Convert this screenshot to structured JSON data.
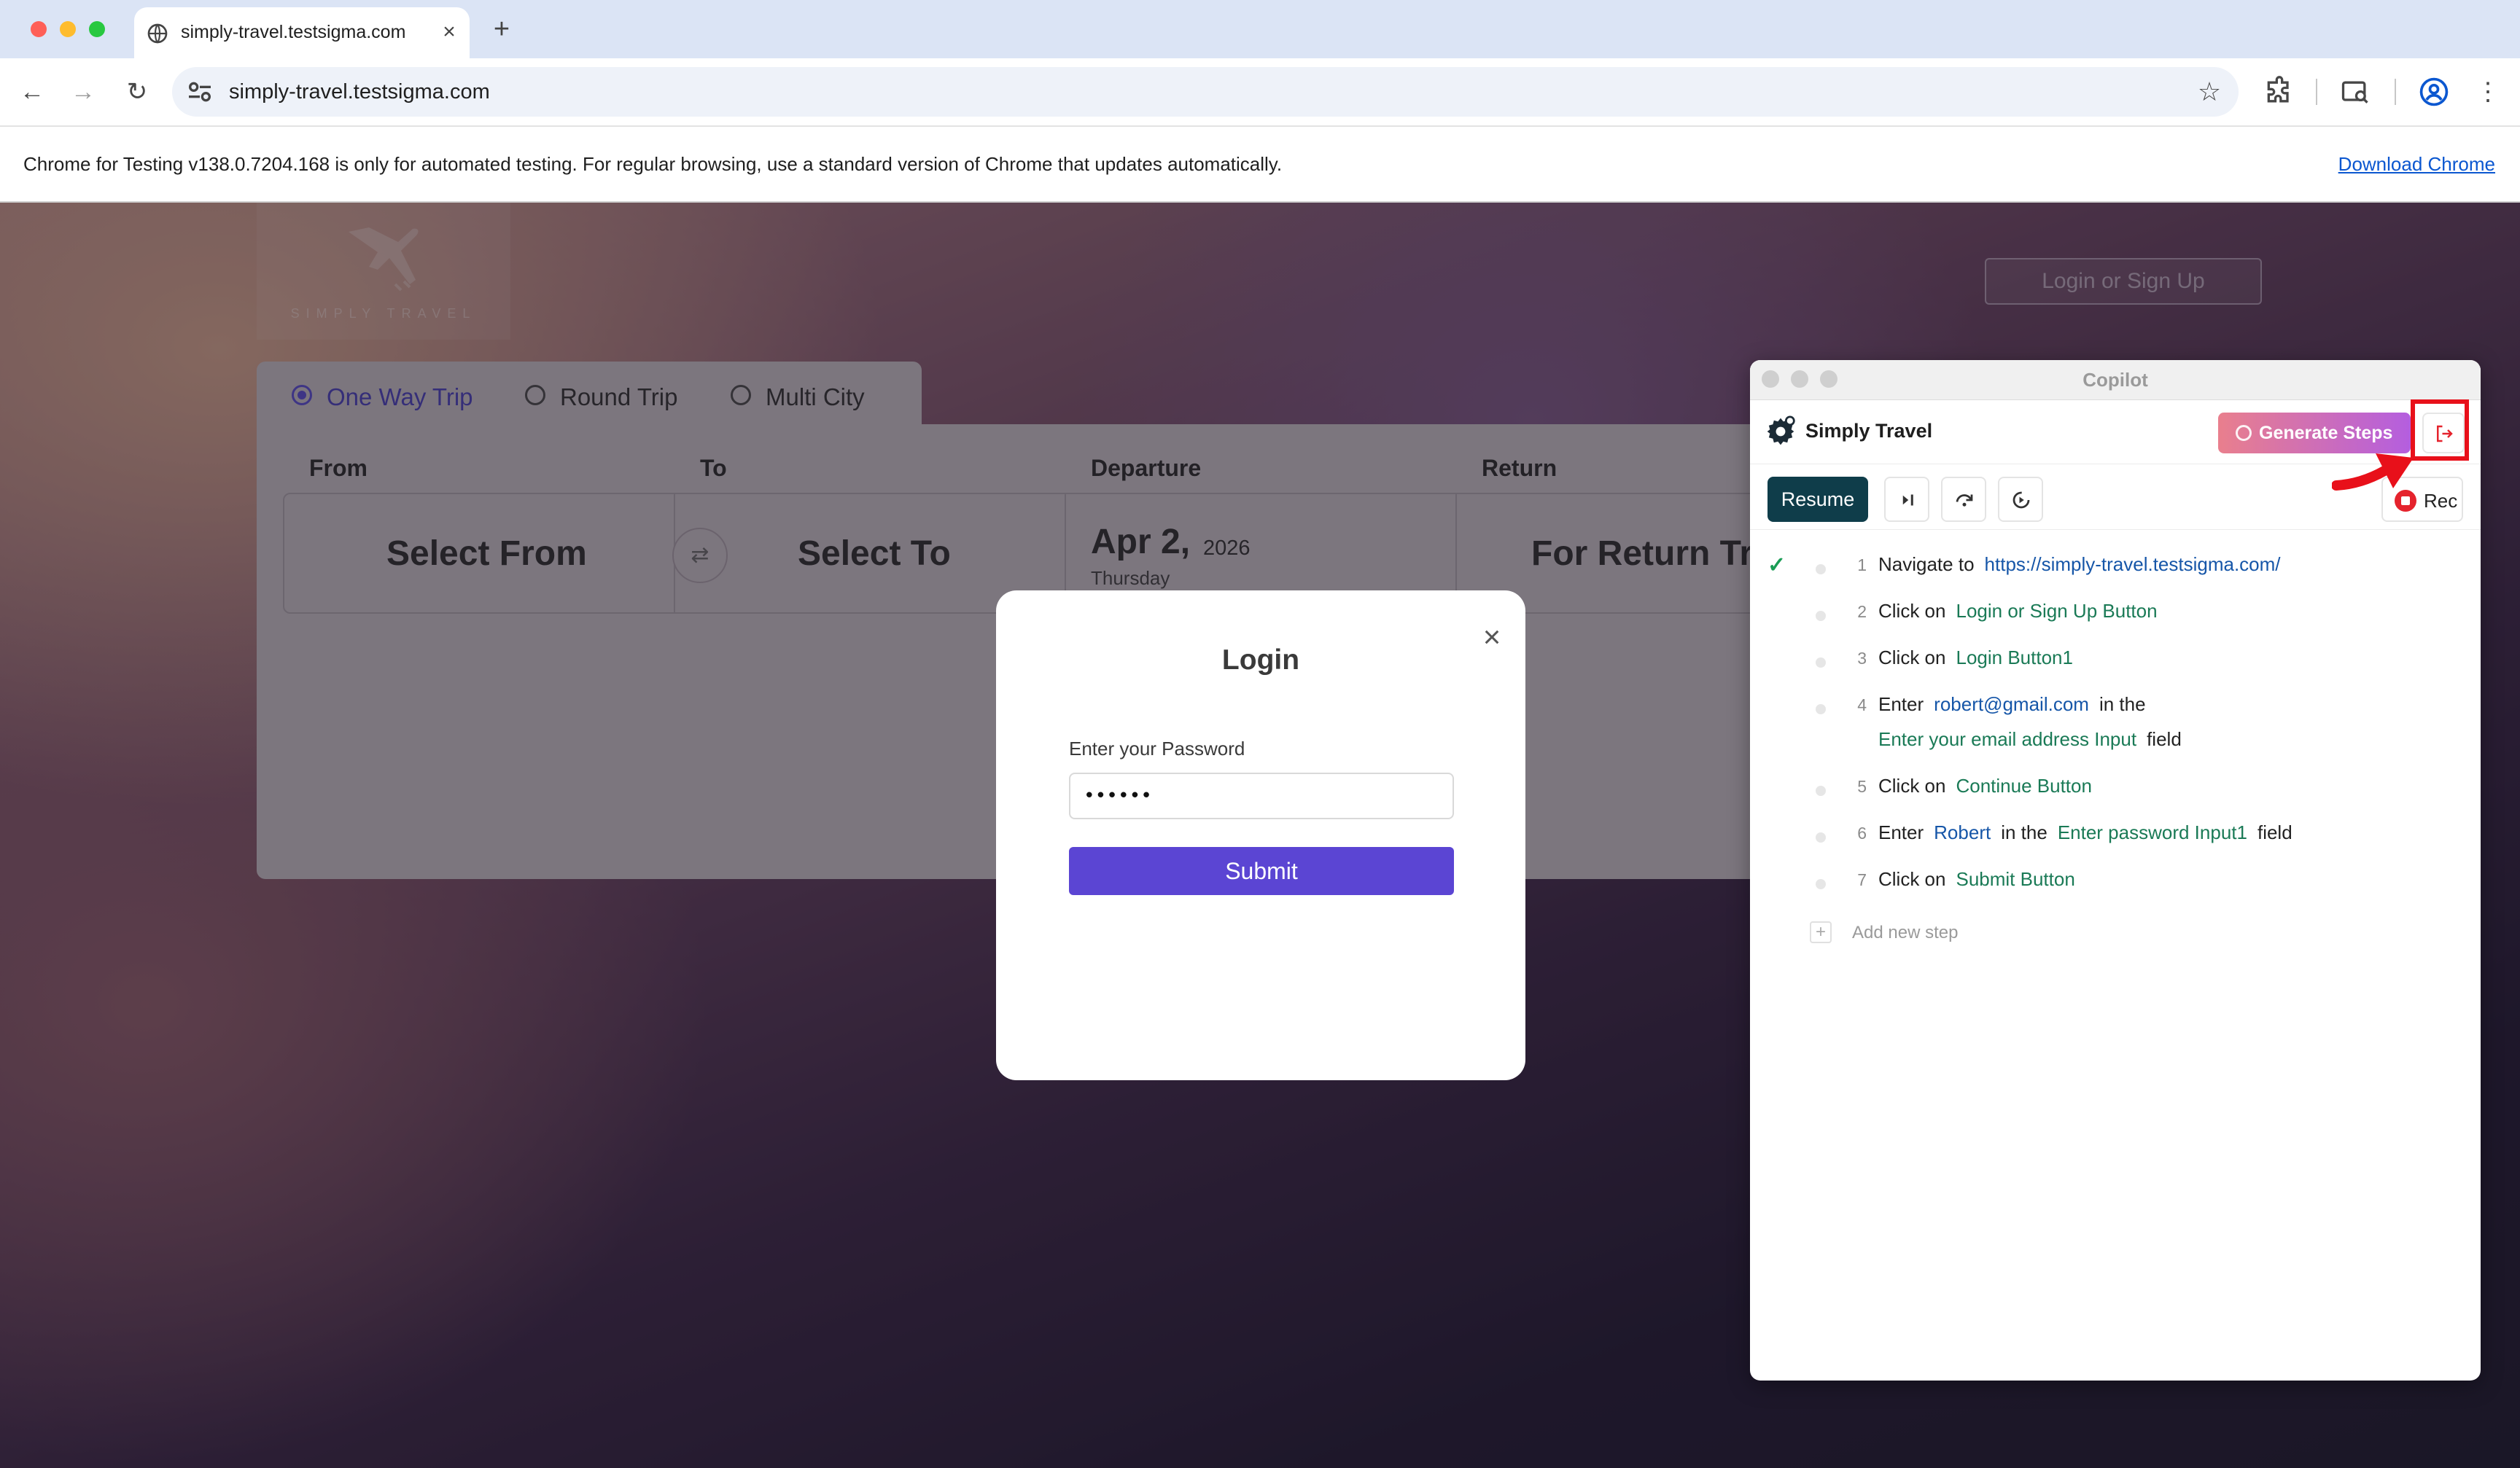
{
  "browser": {
    "tab_title": "simply-travel.testsigma.com",
    "new_tab": "+",
    "tab_close": "×",
    "url": "simply-travel.testsigma.com",
    "infobar_message": "Chrome for Testing v138.0.7204.168 is only for automated testing. For regular browsing, use a standard version of Chrome that updates automatically.",
    "infobar_link": "Download Chrome"
  },
  "site": {
    "brand": "SIMPLY TRAVEL",
    "login_signup": "Login or Sign Up",
    "trip_types": [
      {
        "label": "One Way Trip",
        "selected": true
      },
      {
        "label": "Round Trip",
        "selected": false
      },
      {
        "label": "Multi City",
        "selected": false
      }
    ],
    "fields": {
      "from_header": "From",
      "to_header": "To",
      "departure_header": "Departure",
      "return_header": "Return",
      "from_value": "Select From",
      "to_value": "Select To",
      "departure_date": "Apr 2,",
      "departure_year": "2026",
      "departure_day": "Thursday",
      "return_value": "For Return Trip"
    }
  },
  "login_modal": {
    "title": "Login",
    "password_label": "Enter your Password",
    "password_value": "••••••",
    "submit": "Submit",
    "close": "×"
  },
  "copilot": {
    "window_title": "Copilot",
    "project_name": "Simply Travel",
    "generate_steps": "Generate Steps",
    "resume": "Resume",
    "rec": "Rec",
    "add_step": "Add new step",
    "steps": [
      {
        "num": "1",
        "done": true,
        "action": "Navigate to",
        "value": "https://simply-travel.testsigma.com/"
      },
      {
        "num": "2",
        "done": false,
        "action": "Click on",
        "element": "Login or Sign Up Button"
      },
      {
        "num": "3",
        "done": false,
        "action": "Click on",
        "element": "Login Button1"
      },
      {
        "num": "4",
        "done": false,
        "action": "Enter",
        "value": "robert@gmail.com",
        "mid": "in the",
        "element": "Enter your email address Input",
        "tail": "field"
      },
      {
        "num": "5",
        "done": false,
        "action": "Click on",
        "element": "Continue Button"
      },
      {
        "num": "6",
        "done": false,
        "action": "Enter",
        "value": "Robert",
        "mid": "in the",
        "element": "Enter password Input1",
        "tail": "field"
      },
      {
        "num": "7",
        "done": false,
        "action": "Click on",
        "element": "Submit Button"
      }
    ]
  },
  "colors": {
    "accent_purple": "#5b45d3",
    "resume_bg": "#0f3d4a",
    "highlight_red": "#e8101a",
    "element_green": "#1a7a56",
    "value_blue": "#1656a8"
  }
}
